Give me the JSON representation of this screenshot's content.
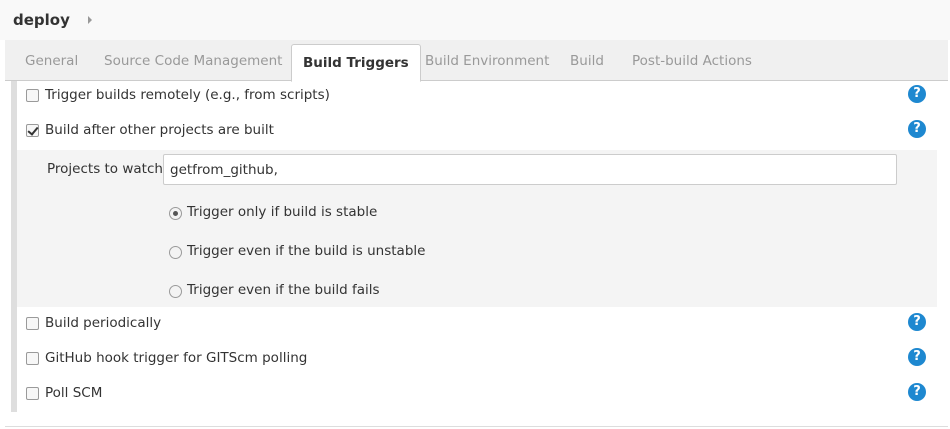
{
  "breadcrumb": {
    "title": "deploy"
  },
  "tabs": [
    {
      "label": "General"
    },
    {
      "label": "Source Code Management"
    },
    {
      "label": "Build Triggers"
    },
    {
      "label": "Build Environment"
    },
    {
      "label": "Build"
    },
    {
      "label": "Post-build Actions"
    }
  ],
  "active_tab": "Build Triggers",
  "triggers": {
    "remote": {
      "label": "Trigger builds remotely (e.g., from scripts)",
      "checked": false
    },
    "after_other": {
      "label": "Build after other projects are built",
      "checked": true
    },
    "periodic": {
      "label": "Build periodically",
      "checked": false
    },
    "github_hook": {
      "label": "GitHub hook trigger for GITScm polling",
      "checked": false
    },
    "poll_scm": {
      "label": "Poll SCM",
      "checked": false
    }
  },
  "projects_to_watch": {
    "label": "Projects to watch",
    "value": "getfrom_github,"
  },
  "trigger_options": [
    {
      "label": "Trigger only if build is stable",
      "selected": true
    },
    {
      "label": "Trigger even if the build is unstable",
      "selected": false
    },
    {
      "label": "Trigger even if the build fails",
      "selected": false
    }
  ],
  "help_icon": "?",
  "colors": {
    "help_blue": "#1e88d0",
    "tab_bar": "#f0f0f0",
    "subpanel": "#f4f4f4"
  }
}
